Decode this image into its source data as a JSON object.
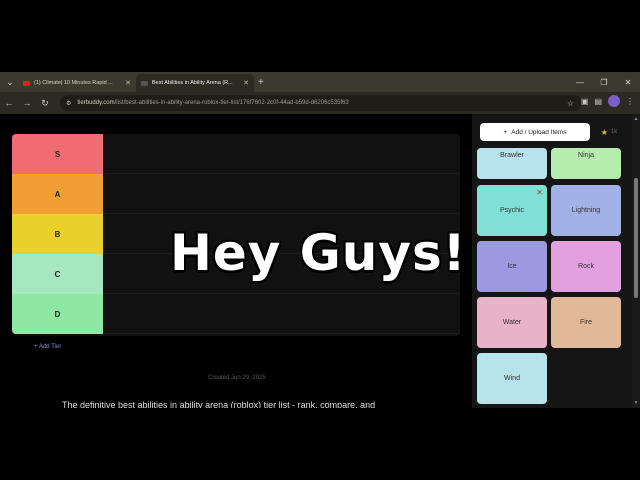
{
  "browser": {
    "tabs": [
      {
        "title": "(1) Climate| 10 Minutes Rapid ...",
        "favicon_color": "#e02020"
      },
      {
        "title": "Best Abilities in Ability Arena (R...",
        "favicon_color": "#444444"
      }
    ],
    "new_tab": "+",
    "url_domain": "tierbuddy.com",
    "url_path": "/list/best-abilities-in-ability-arena-roblox-tier-list/176f7602-2c0f-44ad-b59d-d6206c535f63"
  },
  "tierlist": {
    "tiers": [
      {
        "label": "S",
        "color": "#f16b72"
      },
      {
        "label": "A",
        "color": "#f0a032"
      },
      {
        "label": "B",
        "color": "#ecd02a"
      },
      {
        "label": "C",
        "color": "#a6e6c0"
      },
      {
        "label": "D",
        "color": "#8ee8a4"
      }
    ],
    "add_tier": "Add Tier"
  },
  "overlay_text": "Hey Guys!",
  "created": "Created Jun 29, 2025",
  "description": "The definitive best abilities in ability arena (roblox) tier list - rank, compare, and",
  "panel": {
    "upload_label": "Add / Upload Items",
    "star_count": "1k",
    "items": [
      {
        "label": "Brawler",
        "color": "#b9e3ec"
      },
      {
        "label": "Ninja",
        "color": "#b6ecae"
      },
      {
        "label": "Psychic",
        "color": "#7ee0d6"
      },
      {
        "label": "Lightning",
        "color": "#a3b2e6"
      },
      {
        "label": "Ice",
        "color": "#9b9ae0"
      },
      {
        "label": "Rock",
        "color": "#e2a0e0"
      },
      {
        "label": "Water",
        "color": "#e8b2c8"
      },
      {
        "label": "Fire",
        "color": "#e1b898"
      },
      {
        "label": "Wind",
        "color": "#b7e3ea"
      }
    ]
  }
}
